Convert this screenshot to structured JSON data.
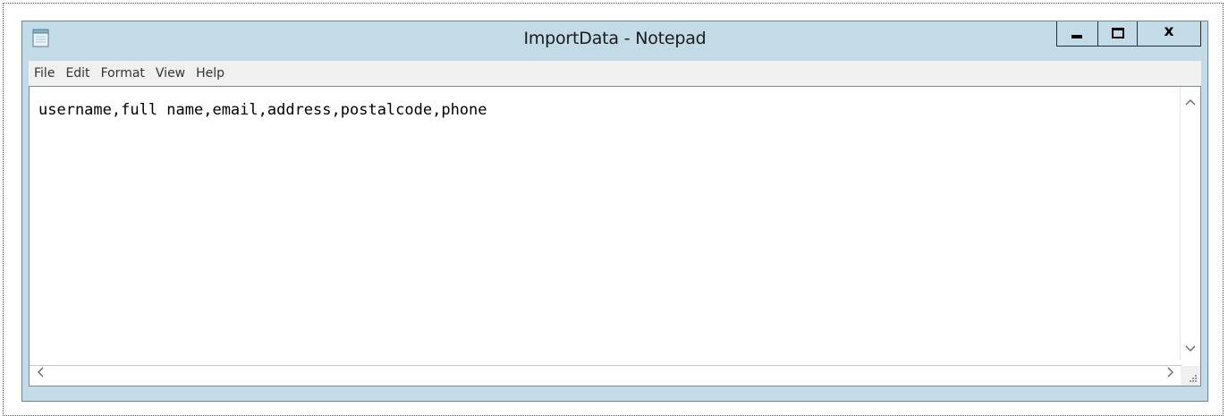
{
  "window": {
    "title": "ImportData - Notepad",
    "icon": "notepad-icon",
    "controls": {
      "minimize_icon": "minimize-icon",
      "maximize_icon": "maximize-icon",
      "close_label": "x"
    }
  },
  "menu": {
    "items": [
      {
        "label": "File"
      },
      {
        "label": "Edit"
      },
      {
        "label": "Format"
      },
      {
        "label": "View"
      },
      {
        "label": "Help"
      }
    ]
  },
  "editor": {
    "content": "username,full name,email,address,postalcode,phone"
  },
  "scrollbars": {
    "up_arrow": "^",
    "down_arrow": "v",
    "left_arrow": "<",
    "right_arrow": ">"
  },
  "colors": {
    "titlebar": "#c2dbe6",
    "menubar": "#f0f0f0",
    "editor_bg": "#ffffff"
  }
}
